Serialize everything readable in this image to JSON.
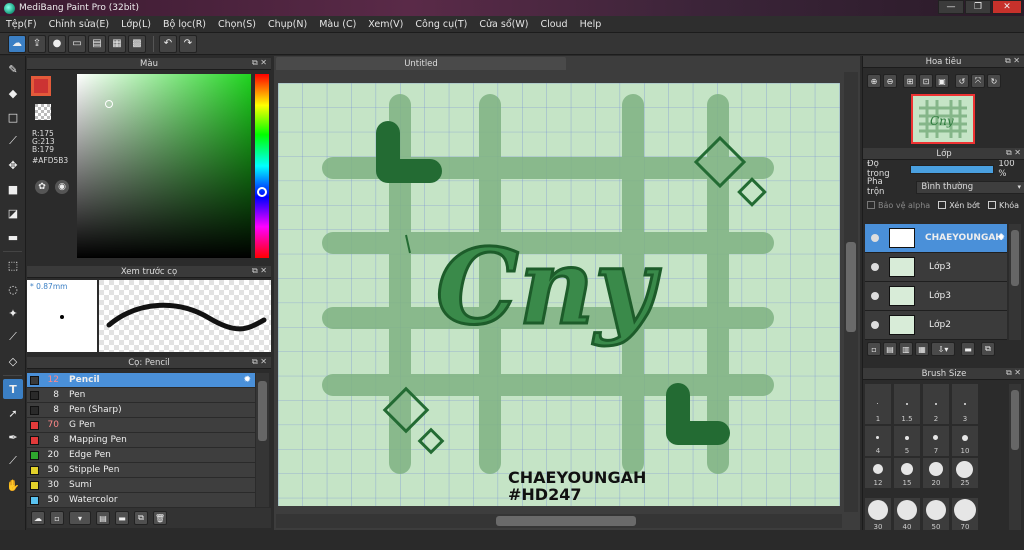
{
  "window": {
    "title": "MediBang Paint Pro (32bit)",
    "min_glyph": "—",
    "max_glyph": "❐",
    "close_glyph": "✕"
  },
  "menu": [
    "Tệp(F)",
    "Chỉnh sửa(E)",
    "Lớp(L)",
    "Bộ lọc(R)",
    "Chọn(S)",
    "Chụp(N)",
    "Màu (C)",
    "Xem(V)",
    "Công cụ(T)",
    "Cửa sổ(W)",
    "Cloud",
    "Help"
  ],
  "toolbar": {
    "icons": [
      "cloud-icon",
      "share-icon",
      "chat-icon",
      "comment-icon",
      "page-icon",
      "panel-icon",
      "grid-icon",
      "undo-icon",
      "redo-icon"
    ]
  },
  "tools": [
    "pen-tool-icon",
    "eraser-icon",
    "rectangle-icon",
    "brush-select-icon",
    "move-icon",
    "fill-icon",
    "bucket-icon",
    "gradient-icon",
    "rect-select-icon",
    "lasso-icon",
    "magic-wand-icon",
    "select-pen-icon",
    "select-eraser-icon",
    "text-icon",
    "operation-icon",
    "eyedropper-icon",
    "dropper-icon",
    "hand-icon"
  ],
  "color_panel": {
    "title": "Màu",
    "r": "R:175",
    "g": "G:213",
    "b": "B:179",
    "hex": "#AFD5B3",
    "fg_color": "#e35a3a",
    "hue_color": "#1fd41f"
  },
  "brush_preview": {
    "title": "Xem trước cọ",
    "size": "* 0.87mm"
  },
  "brush_list": {
    "title": "Cọ: Pencil",
    "items": [
      {
        "size": "12",
        "name": "Pencil",
        "color": "#3a3a3a",
        "selected": true
      },
      {
        "size": "8",
        "name": "Pen",
        "color": "#2a2a2a"
      },
      {
        "size": "8",
        "name": "Pen (Sharp)",
        "color": "#2a2a2a"
      },
      {
        "size": "70",
        "name": "G Pen",
        "color": "#e23a3a"
      },
      {
        "size": "8",
        "name": "Mapping Pen",
        "color": "#e23a3a"
      },
      {
        "size": "20",
        "name": "Edge Pen",
        "color": "#2ea82e"
      },
      {
        "size": "50",
        "name": "Stipple Pen",
        "color": "#e2d12a"
      },
      {
        "size": "30",
        "name": "Sumi",
        "color": "#e2d12a"
      },
      {
        "size": "50",
        "name": "Watercolor",
        "color": "#59c2f0"
      }
    ]
  },
  "document": {
    "tab": "Untitled",
    "bg_color": "#c5e4c6",
    "title_text": "Cny",
    "credit_line1": "CHAEYOUNGAH",
    "credit_line2": "#HD247"
  },
  "navigator": {
    "title": "Hoa tiêu",
    "thumb_text": "Cny"
  },
  "layers": {
    "title": "Lớp",
    "opacity_label": "Độ trong",
    "opacity_value": "100 %",
    "opacity": 1.0,
    "blend_label": "Pha trộn",
    "blend_value": "Bình thường",
    "protect_alpha": "Bảo vệ alpha",
    "clipping": "Xén bớt",
    "lock": "Khóa",
    "items": [
      {
        "name": "CHAEYOUNGAH",
        "selected": true
      },
      {
        "name": "Lớp3"
      },
      {
        "name": "Lớp3"
      },
      {
        "name": "Lớp2"
      }
    ]
  },
  "brush_size": {
    "title": "Brush Size",
    "sizes": [
      "",
      "",
      "",
      "",
      "1",
      "1.5",
      "2",
      "3",
      "4",
      "5",
      "7",
      "10",
      "12",
      "15",
      "20",
      "25",
      "30",
      "40",
      "50",
      "70"
    ]
  }
}
